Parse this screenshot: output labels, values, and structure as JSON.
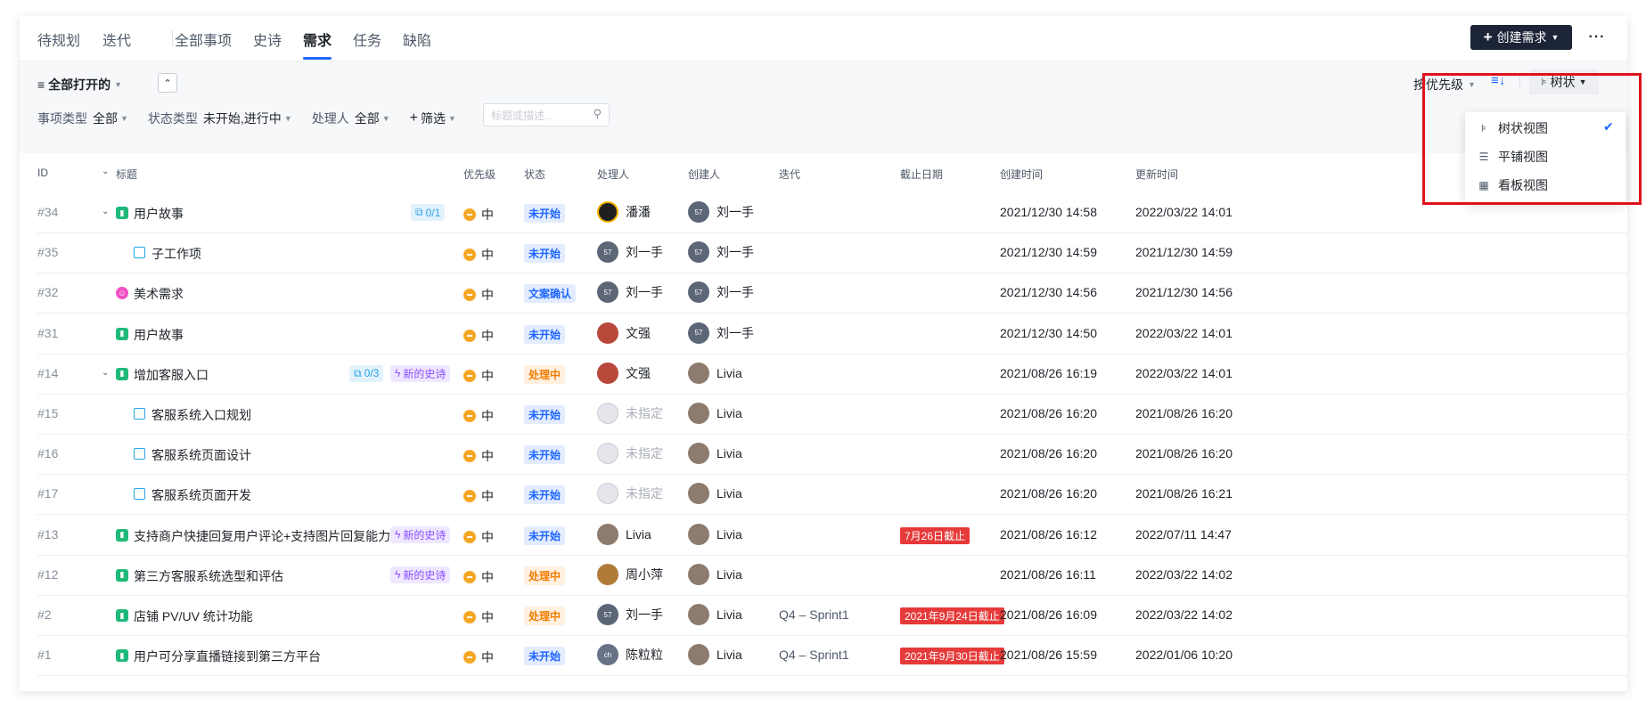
{
  "nav": {
    "tabs": [
      "待规划",
      "迭代",
      "全部事项",
      "史诗",
      "需求",
      "任务",
      "缺陷"
    ],
    "active": "需求",
    "create_label": "创建需求",
    "more_label": "···"
  },
  "filters": {
    "open_label": "全部打开的",
    "type_key": "事项类型",
    "type_val": "全部",
    "state_key": "状态类型",
    "state_val": "未开始,进行中",
    "assignee_key": "处理人",
    "assignee_val": "全部",
    "add_filter": "筛选",
    "search_placeholder": "标题或描述..."
  },
  "view_controls": {
    "sort_label": "按优先级",
    "view_label": "树状",
    "menu": [
      "树状视图",
      "平铺视图",
      "看板视图"
    ],
    "selected": "树状视图"
  },
  "columns": {
    "id": "ID",
    "title": "标题",
    "priority": "优先级",
    "status": "状态",
    "assignee": "处理人",
    "creator": "创建人",
    "iteration": "迭代",
    "due": "截止日期",
    "created": "创建时间",
    "updated": "更新时间"
  },
  "rows": [
    {
      "id": "#34",
      "title": "用户故事",
      "level": 0,
      "expand": true,
      "type": "story",
      "sub_tag": "0/1",
      "epic_tag": "",
      "priority": "中",
      "status": "未开始",
      "status_color": "blue",
      "assignee": "潘潘",
      "assignee_avatar": "penguin",
      "creator": "刘一手",
      "creator_avatar": "57",
      "iteration": "",
      "due": "",
      "created": "2021/12/30 14:58",
      "updated": "2022/03/22 14:01"
    },
    {
      "id": "#35",
      "title": "子工作项",
      "level": 1,
      "expand": false,
      "type": "task",
      "sub_tag": "",
      "epic_tag": "",
      "priority": "中",
      "status": "未开始",
      "status_color": "blue",
      "assignee": "刘一手",
      "assignee_avatar": "57",
      "creator": "刘一手",
      "creator_avatar": "57",
      "iteration": "",
      "due": "",
      "created": "2021/12/30 14:59",
      "updated": "2021/12/30 14:59"
    },
    {
      "id": "#32",
      "title": "美术需求",
      "level": 0,
      "expand": false,
      "type": "art",
      "sub_tag": "",
      "epic_tag": "",
      "priority": "中",
      "status": "文案确认",
      "status_color": "blue",
      "assignee": "刘一手",
      "assignee_avatar": "57",
      "creator": "刘一手",
      "creator_avatar": "57",
      "iteration": "",
      "due": "",
      "created": "2021/12/30 14:56",
      "updated": "2021/12/30 14:56"
    },
    {
      "id": "#31",
      "title": "用户故事",
      "level": 0,
      "expand": false,
      "type": "story",
      "sub_tag": "",
      "epic_tag": "",
      "priority": "中",
      "status": "未开始",
      "status_color": "blue",
      "assignee": "文强",
      "assignee_avatar": "hero",
      "creator": "刘一手",
      "creator_avatar": "57",
      "iteration": "",
      "due": "",
      "created": "2021/12/30 14:50",
      "updated": "2022/03/22 14:01"
    },
    {
      "id": "#14",
      "title": "增加客服入口",
      "level": 0,
      "expand": true,
      "type": "story",
      "sub_tag": "0/3",
      "epic_tag": "新的史诗",
      "priority": "中",
      "status": "处理中",
      "status_color": "orange",
      "assignee": "文强",
      "assignee_avatar": "hero",
      "creator": "Livia",
      "creator_avatar": "livia",
      "iteration": "",
      "due": "",
      "created": "2021/08/26 16:19",
      "updated": "2022/03/22 14:01"
    },
    {
      "id": "#15",
      "title": "客服系统入口规划",
      "level": 1,
      "expand": false,
      "type": "task",
      "sub_tag": "",
      "epic_tag": "",
      "priority": "中",
      "status": "未开始",
      "status_color": "blue",
      "assignee": "未指定",
      "assignee_avatar": "empty",
      "creator": "Livia",
      "creator_avatar": "livia",
      "iteration": "",
      "due": "",
      "created": "2021/08/26 16:20",
      "updated": "2021/08/26 16:20"
    },
    {
      "id": "#16",
      "title": "客服系统页面设计",
      "level": 1,
      "expand": false,
      "type": "task",
      "sub_tag": "",
      "epic_tag": "",
      "priority": "中",
      "status": "未开始",
      "status_color": "blue",
      "assignee": "未指定",
      "assignee_avatar": "empty",
      "creator": "Livia",
      "creator_avatar": "livia",
      "iteration": "",
      "due": "",
      "created": "2021/08/26 16:20",
      "updated": "2021/08/26 16:20"
    },
    {
      "id": "#17",
      "title": "客服系统页面开发",
      "level": 1,
      "expand": false,
      "type": "task",
      "sub_tag": "",
      "epic_tag": "",
      "priority": "中",
      "status": "未开始",
      "status_color": "blue",
      "assignee": "未指定",
      "assignee_avatar": "empty",
      "creator": "Livia",
      "creator_avatar": "livia",
      "iteration": "",
      "due": "",
      "created": "2021/08/26 16:20",
      "updated": "2021/08/26 16:21"
    },
    {
      "id": "#13",
      "title": "支持商户快捷回复用户评论+支持图片回复能力",
      "level": 0,
      "expand": false,
      "type": "story",
      "sub_tag": "",
      "epic_tag": "新的史诗",
      "priority": "中",
      "status": "未开始",
      "status_color": "blue",
      "assignee": "Livia",
      "assignee_avatar": "livia",
      "creator": "Livia",
      "creator_avatar": "livia",
      "iteration": "",
      "due": "7月26日截止",
      "created": "2021/08/26 16:12",
      "updated": "2022/07/11 14:47"
    },
    {
      "id": "#12",
      "title": "第三方客服系统选型和评估",
      "level": 0,
      "expand": false,
      "type": "story",
      "sub_tag": "",
      "epic_tag": "新的史诗",
      "priority": "中",
      "status": "处理中",
      "status_color": "orange",
      "assignee": "周小萍",
      "assignee_avatar": "zhou",
      "creator": "Livia",
      "creator_avatar": "livia",
      "iteration": "",
      "due": "",
      "created": "2021/08/26 16:11",
      "updated": "2022/03/22 14:02"
    },
    {
      "id": "#2",
      "title": "店铺 PV/UV 统计功能",
      "level": 0,
      "expand": false,
      "type": "story",
      "sub_tag": "",
      "epic_tag": "",
      "priority": "中",
      "status": "处理中",
      "status_color": "orange",
      "assignee": "刘一手",
      "assignee_avatar": "57",
      "creator": "Livia",
      "creator_avatar": "livia",
      "iteration": "Q4 – Sprint1",
      "due": "2021年9月24日截止",
      "created": "2021/08/26 16:09",
      "updated": "2022/03/22 14:02"
    },
    {
      "id": "#1",
      "title": "用户可分享直播链接到第三方平台",
      "level": 0,
      "expand": false,
      "type": "story",
      "sub_tag": "",
      "epic_tag": "",
      "priority": "中",
      "status": "未开始",
      "status_color": "blue",
      "assignee": "陈粒粒",
      "assignee_avatar": "ch",
      "creator": "Livia",
      "creator_avatar": "livia",
      "iteration": "Q4 – Sprint1",
      "due": "2021年9月30日截止",
      "created": "2021/08/26 15:59",
      "updated": "2022/01/06 10:20"
    }
  ]
}
